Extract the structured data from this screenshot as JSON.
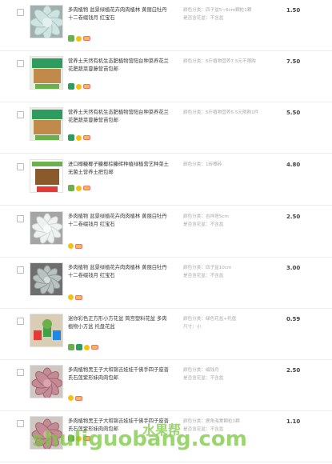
{
  "colors": {
    "border": "#ededed",
    "price": "#444444",
    "props": "#a8a8a8",
    "watermark": "#78c83c"
  },
  "rows": [
    {
      "title": "多肉植物 盆景绿植花卉肉肉植林 黄丽白牡丹十二卷缀钱月 红宝石",
      "props": [
        "颜色分类：四子盆5~6cm颗粒1颗",
        "是否含花盆：不含盆"
      ],
      "price": "1.50",
      "thumb": "succulent-blue",
      "icons": [
        "g",
        "y",
        "s"
      ]
    },
    {
      "title": "营养土天然有机生态肥植物营阳台种菜养花兰花肥蔬菜蔓藤营苗包邮",
      "props": [
        "颜色分类：5斤植物营养7.5元不限购"
      ],
      "price": "7.50",
      "thumb": "soil-bag",
      "icons": [
        "t",
        "y",
        "s"
      ]
    },
    {
      "title": "营养土天然有机生态肥植物营阳台种菜养花兰花肥蔬菜蔓藤营苗包邮",
      "props": [
        "颜色分类：5斤植物营养5.5元限购1件"
      ],
      "price": "5.50",
      "thumb": "soil-bag",
      "icons": [
        "t",
        "y",
        "s"
      ]
    },
    {
      "title": "进口椰糠椰子糠椰棕糠砖种植绿植营艺种菜土无菌土营养土把包邮",
      "props": [
        "颜色分类：1砖椰砖"
      ],
      "price": "4.80",
      "thumb": "coco-brick",
      "icons": [
        "g",
        "y",
        "s"
      ]
    },
    {
      "title": "多肉植物 盆景绿植花卉肉肉植林 黄丽白牡丹十二卷缀钱月 红宝石",
      "props": [
        "颜色分类：吉祥塔5cm",
        "是否含花盆：不含盆"
      ],
      "price": "2.50",
      "thumb": "succulent-white",
      "icons": [
        "y",
        "s"
      ]
    },
    {
      "title": "多肉植物 盆景绿植花卉肉肉植林 黄丽白牡丹十二卷缀钱月 红宝石",
      "props": [
        "颜色分类：四子盆10cm",
        "是否含花盆：不含盆"
      ],
      "price": "3.00",
      "thumb": "succulent-gray",
      "icons": [
        "y",
        "s"
      ]
    },
    {
      "title": "迷你彩色正方形小方花盆 简宫塑料花盆 多肉植物小方盆 托盘花盆",
      "props": [
        "颜色分类：绿色花盆+托盘",
        "尺寸：小"
      ],
      "price": "0.59",
      "thumb": "pots",
      "icons": [
        "g",
        "t",
        "y",
        "s"
      ]
    },
    {
      "title": "多肉植物黑王子大和锦吉娃娃千佛手四子座普氏石莲紫形妹肉肉包邮",
      "props": [
        "颜色分类：缀钱月",
        "是否含花盆：不含盆"
      ],
      "price": "2.50",
      "thumb": "succulent-pink",
      "icons": [
        "y",
        "s"
      ]
    },
    {
      "title": "多肉植物黑王子大和锦吉娃娃千佛手四子座普氏石莲紫形妹肉肉包邮",
      "props": [
        "颜色分类：鹿角海棠颗粒1颗",
        "是否含花盆：不含盆"
      ],
      "price": "1.10",
      "thumb": "succulent-pink",
      "icons": [
        "g",
        "y",
        "s"
      ]
    }
  ],
  "watermark": {
    "main": "shuliguobang",
    "suffix": ".com",
    "cn": "水果帮"
  }
}
